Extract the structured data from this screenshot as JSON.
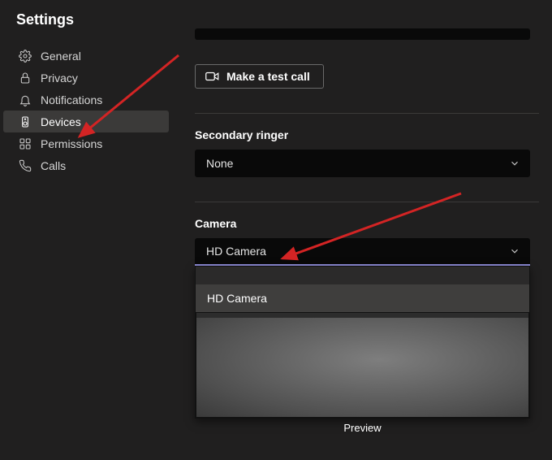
{
  "header": {
    "title": "Settings"
  },
  "sidebar": {
    "items": [
      {
        "label": "General"
      },
      {
        "label": "Privacy"
      },
      {
        "label": "Notifications"
      },
      {
        "label": "Devices"
      },
      {
        "label": "Permissions"
      },
      {
        "label": "Calls"
      }
    ]
  },
  "main": {
    "test_call_label": "Make a test call",
    "secondary_ringer": {
      "label": "Secondary ringer",
      "value": "None"
    },
    "camera": {
      "label": "Camera",
      "value": "HD Camera",
      "options": [
        "HD Camera"
      ]
    },
    "preview_label": "Preview"
  },
  "colors": {
    "accent": "#8e8cd8",
    "arrow": "#d32424"
  }
}
